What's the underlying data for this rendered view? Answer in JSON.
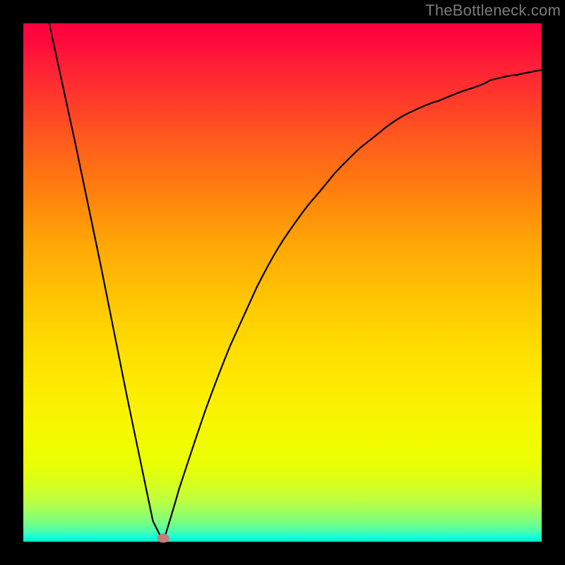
{
  "attribution": "TheBottleneck.com",
  "chart_data": {
    "type": "line",
    "title": "",
    "xlabel": "",
    "ylabel": "",
    "xlim": [
      0,
      100
    ],
    "ylim": [
      0,
      100
    ],
    "series": [
      {
        "name": "curve",
        "x": [
          5,
          10,
          15,
          20,
          25,
          27,
          30,
          35,
          40,
          45,
          50,
          55,
          60,
          65,
          70,
          75,
          80,
          85,
          90,
          95,
          100
        ],
        "y": [
          100,
          77,
          53,
          28,
          4,
          0,
          10,
          25,
          38,
          49,
          58,
          65,
          71,
          76,
          80,
          83,
          85,
          87,
          89,
          90,
          91
        ]
      }
    ],
    "marker": {
      "name": "minimum-dot",
      "x": 27,
      "y": 0
    }
  }
}
